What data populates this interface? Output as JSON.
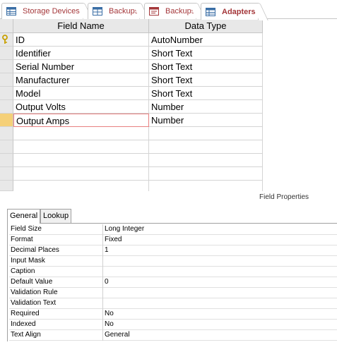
{
  "tabs": [
    {
      "label": "Storage Devices",
      "icon": "table-icon",
      "active": false
    },
    {
      "label": "Backups",
      "icon": "query-icon",
      "active": false
    },
    {
      "label": "Backups",
      "icon": "report-icon",
      "active": false
    },
    {
      "label": "Adapters",
      "icon": "table-icon",
      "active": true
    }
  ],
  "grid": {
    "col_field_name": "Field Name",
    "col_data_type": "Data Type",
    "rows": [
      {
        "name": "ID",
        "type": "AutoNumber",
        "primary_key": true
      },
      {
        "name": "Identifier",
        "type": "Short Text"
      },
      {
        "name": "Serial Number",
        "type": "Short Text"
      },
      {
        "name": "Manufacturer",
        "type": "Short Text"
      },
      {
        "name": "Model",
        "type": "Short Text"
      },
      {
        "name": "Output Volts",
        "type": "Number"
      },
      {
        "name": "Output Amps",
        "type": "Number",
        "current": true
      }
    ]
  },
  "field_properties_label": "Field Properties",
  "prop_tabs": {
    "general": "General",
    "lookup": "Lookup"
  },
  "properties": [
    {
      "name": "Field Size",
      "value": "Long Integer"
    },
    {
      "name": "Format",
      "value": "Fixed"
    },
    {
      "name": "Decimal Places",
      "value": "1"
    },
    {
      "name": "Input Mask",
      "value": ""
    },
    {
      "name": "Caption",
      "value": ""
    },
    {
      "name": "Default Value",
      "value": "0"
    },
    {
      "name": "Validation Rule",
      "value": ""
    },
    {
      "name": "Validation Text",
      "value": ""
    },
    {
      "name": "Required",
      "value": "No"
    },
    {
      "name": "Indexed",
      "value": "No"
    },
    {
      "name": "Text Align",
      "value": "General"
    }
  ],
  "colors": {
    "accent_tab_text": "#a4373a",
    "current_row_selector": "#f5d078",
    "key_icon": "#c8a000"
  }
}
